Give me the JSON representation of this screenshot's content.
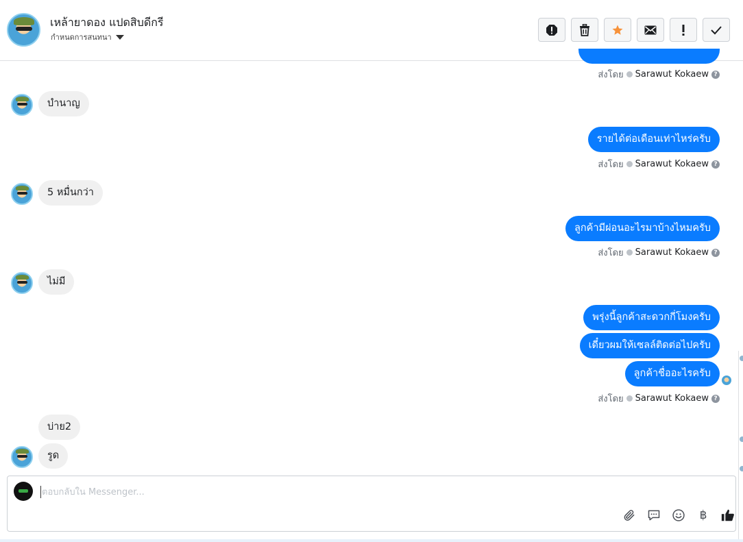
{
  "header": {
    "contact_name": "เหล้ายาดอง แปดสิบดีกรี",
    "assign_label": "กำหนดการสนทนา"
  },
  "toolbar": {
    "icons": [
      "alert-octagon-icon",
      "trash-icon",
      "star-icon",
      "envelope-icon",
      "exclamation-icon",
      "check-icon"
    ],
    "star_color": "#f7923a"
  },
  "messages": {
    "sent_by_prefix": "ส่งโดย",
    "sender_name": "Sarawut Kokaew",
    "in_1": "บำนาญ",
    "out_1": "รายได้ต่อเดือนเท่าไหร่ครับ",
    "in_2": "5 หมื่นกว่า",
    "out_2": "ลูกค้ามีผ่อนอะไรมาบ้างไหมครับ",
    "in_3": "ไม่มี",
    "out_3": "พรุ่งนี้ลูกค้าสะดวกกี่โมงครับ",
    "out_4": "เดี๋ยวผมให้เซลล์ติดต่อไปครับ",
    "out_5": "ลูกค้าชื่ออะไรครับ",
    "in_4": "บ่าย2",
    "in_5": "รูด"
  },
  "composer": {
    "placeholder": "ตอบกลับใน Messenger...",
    "tools": [
      "attach-icon",
      "saved-reply-icon",
      "emoji-icon",
      "baht-icon",
      "thumbs-up-icon"
    ],
    "baht_symbol": "฿"
  },
  "colors": {
    "outgoing_bubble": "#0a7cff",
    "incoming_bubble": "#f0f0f0"
  }
}
